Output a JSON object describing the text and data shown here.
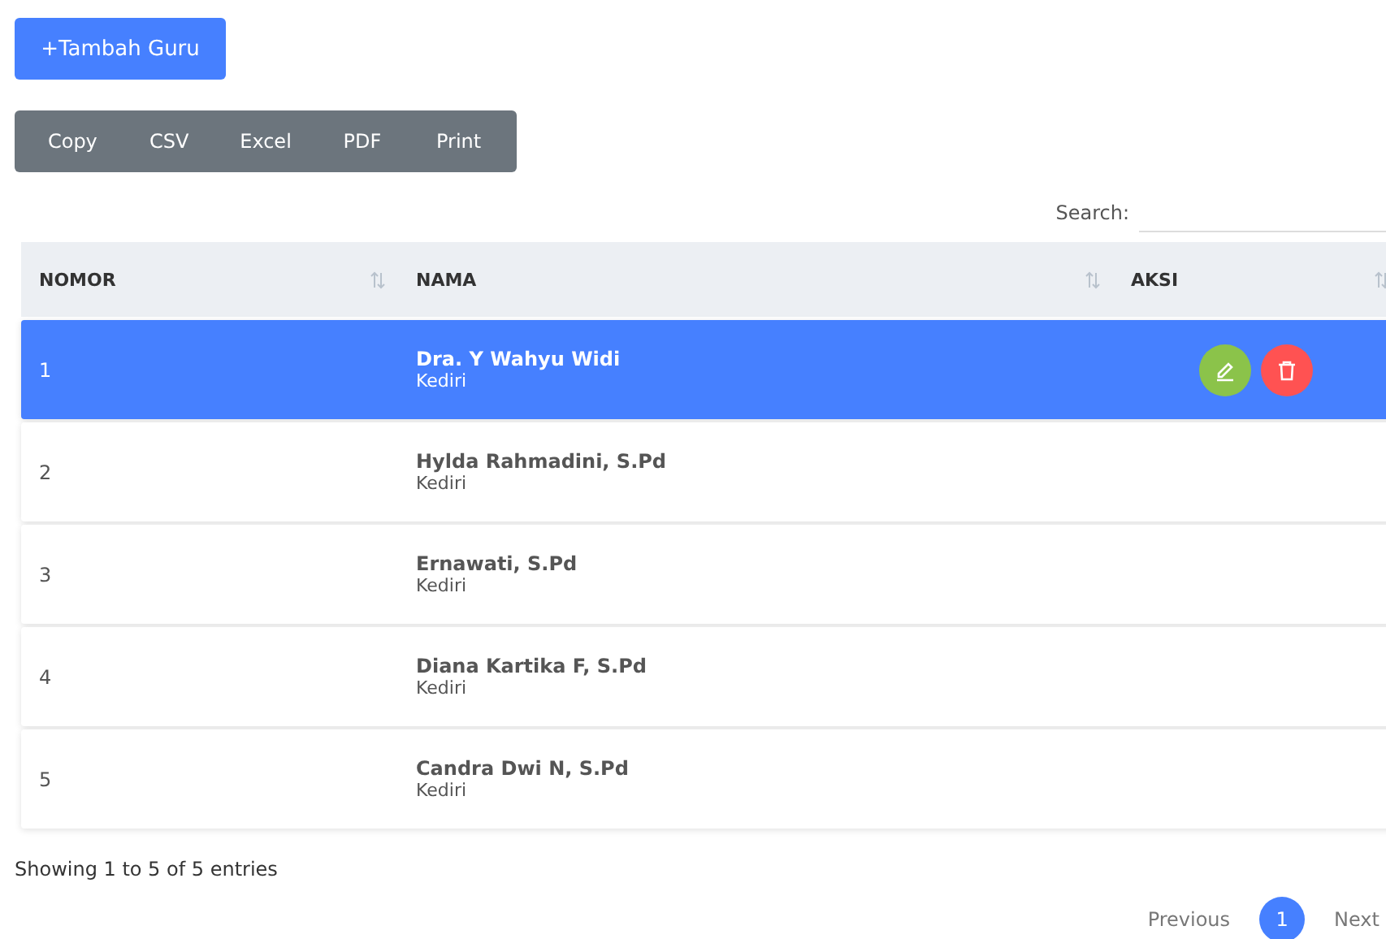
{
  "add_button": {
    "label": "+Tambah Guru"
  },
  "export_buttons": [
    "Copy",
    "CSV",
    "Excel",
    "PDF",
    "Print"
  ],
  "search": {
    "label": "Search:"
  },
  "table": {
    "columns": [
      "NOMOR",
      "NAMA",
      "AKSI"
    ],
    "rows": [
      {
        "nomor": "1",
        "name": "Dra. Y Wahyu Widi",
        "city": "Kediri",
        "selected": true
      },
      {
        "nomor": "2",
        "name": "Hylda Rahmadini, S.Pd",
        "city": "Kediri",
        "selected": false
      },
      {
        "nomor": "3",
        "name": "Ernawati, S.Pd",
        "city": "Kediri",
        "selected": false
      },
      {
        "nomor": "4",
        "name": "Diana Kartika F, S.Pd",
        "city": "Kediri",
        "selected": false
      },
      {
        "nomor": "5",
        "name": "Candra Dwi N, S.Pd",
        "city": "Kediri",
        "selected": false
      }
    ]
  },
  "info": "Showing 1 to 5 of 5 entries",
  "pagination": {
    "previous": "Previous",
    "pages": [
      {
        "label": "1",
        "selected": true
      }
    ],
    "next": "Next"
  }
}
